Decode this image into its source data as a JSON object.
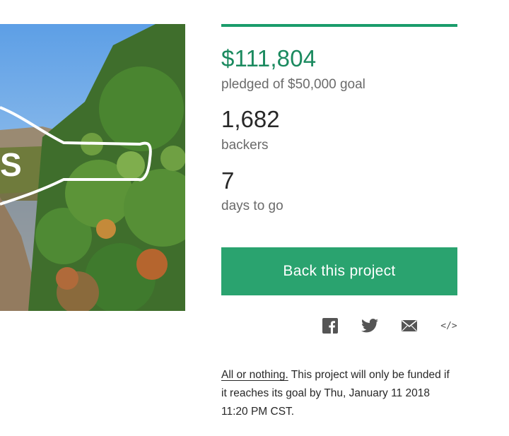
{
  "campaign": {
    "pledged_amount": "$111,804",
    "pledged_label": "pledged of $50,000 goal",
    "funded_fraction": 1.0,
    "backers_count": "1,682",
    "backers_label": "backers",
    "days_left": "7",
    "days_label": "days to go"
  },
  "actions": {
    "back_project_label": "Back this project"
  },
  "share": {
    "icons": [
      "facebook-icon",
      "twitter-icon",
      "email-icon",
      "embed-icon"
    ],
    "embed_glyph": "</>"
  },
  "funding_note": {
    "link_text": "All or nothing.",
    "body": " This project will only be funded if it reaches its goal by Thu, January 11 2018 11:20 PM CST."
  },
  "colors": {
    "accent": "#2aa36f",
    "pledged_text": "#1b8a5f",
    "label_text": "#6b6b6b"
  }
}
